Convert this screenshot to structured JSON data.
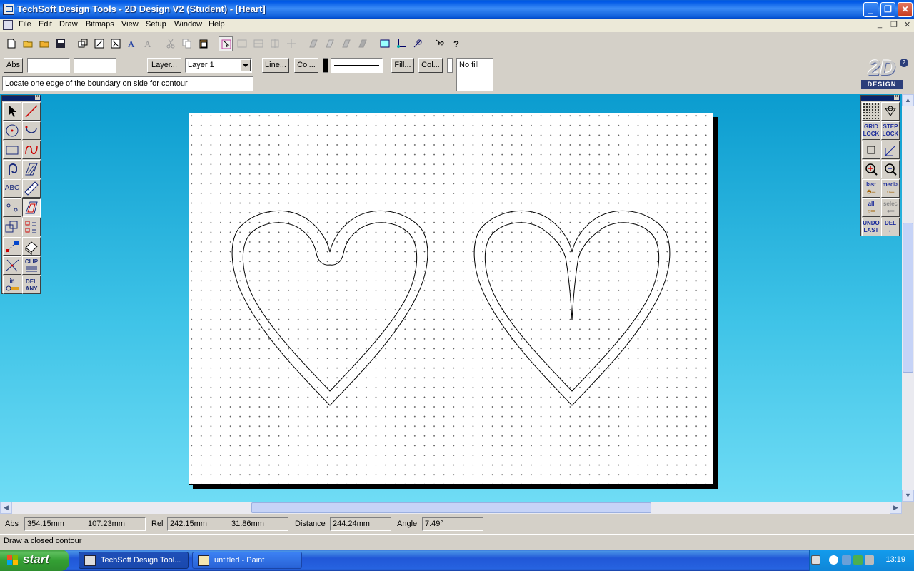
{
  "window": {
    "title": "TechSoft Design Tools - 2D Design V2 (Student) - [Heart]"
  },
  "menu": {
    "items": [
      "File",
      "Edit",
      "Draw",
      "Bitmaps",
      "View",
      "Setup",
      "Window",
      "Help"
    ]
  },
  "properties": {
    "abs_label": "Abs",
    "field1_value": "",
    "field2_value": "",
    "layer_button": "Layer...",
    "layer_selected": "Layer 1",
    "line_button": "Line...",
    "line_col_button": "Col...",
    "fill_button": "Fill...",
    "fill_col_button": "Col...",
    "fill_value": "No fill",
    "prompt": "Locate one edge of the boundary on side for contour"
  },
  "logo": {
    "text": "2D",
    "subtext": "DESIGN"
  },
  "left_tools": {
    "text_tool": "ABC",
    "clip_tool": "CLIP",
    "in_tool": "in",
    "del_any_tool": "DEL ANY"
  },
  "right_tools": {
    "grid_lock": "GRID LOCK",
    "step_lock": "STEP LOCK",
    "last": "last",
    "media": "media",
    "all": "all",
    "select": "selec",
    "undo_last": "UNDO LAST",
    "del": "DEL"
  },
  "coords": {
    "abs_label": "Abs",
    "abs_x": "354.15mm",
    "abs_y": "107.23mm",
    "rel_label": "Rel",
    "rel_x": "242.15mm",
    "rel_y": "31.86mm",
    "distance_label": "Distance",
    "distance": "244.24mm",
    "angle_label": "Angle",
    "angle": "7.49°"
  },
  "status": {
    "text": "Draw a closed contour"
  },
  "taskbar": {
    "start": "start",
    "tasks": [
      "TechSoft Design Tool...",
      "untitled - Paint"
    ],
    "clock": "13:19"
  },
  "colors": {
    "title_blue": "#0058e6",
    "work_top": "#0b9ccf",
    "work_bottom": "#6fdcf5",
    "start_green": "#34a034"
  }
}
